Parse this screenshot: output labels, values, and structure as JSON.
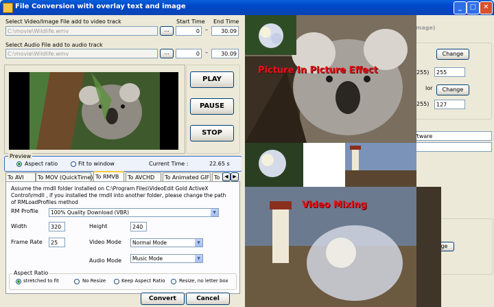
{
  "window": {
    "title": "File Conversion with overlay text and image"
  },
  "video_input": {
    "label": "Select Video/Image File add to video track",
    "path": "C:\\movie\\Wildlife.wmv",
    "browse": "...",
    "start_label": "Start Time",
    "end_label": "End Time",
    "start": "0",
    "dash": "–",
    "end": "30.09"
  },
  "audio_input": {
    "label": "Select Audio File add to audio track",
    "path": "C:\\movie\\Wildlife.wmv",
    "browse": "...",
    "start": "0",
    "dash": "–",
    "end": "30.09"
  },
  "controls": {
    "play": "PLAY",
    "pause": "PAUSE",
    "stop": "STOP"
  },
  "preview": {
    "legend": "Preview",
    "aspect": "Aspect ratio",
    "fit": "Fit to window",
    "current_label": "Current Time :",
    "current_value": "22.65 s"
  },
  "tabs": [
    "To  AVI",
    "To MOV (QuickTime)",
    "To RMVB",
    "To AVCHD",
    "To Animated GIF",
    "To"
  ],
  "rmvb": {
    "note": "Assume the rmdll folder installed on C:\\Program Files\\VideoEdit Gold ActiveX Control\\rmdll , if you installed the rmdll into another folder, please change the path of RMLoadProfiles method",
    "profile_label": "RM Profile",
    "profile_value": "100% Quality Download (VBR)",
    "width_label": "Width",
    "width_value": "320",
    "height_label": "Height",
    "height_value": "240",
    "framerate_label": "Frame Rate",
    "framerate_value": "25",
    "video_mode_label": "Video Mode",
    "video_mode_value": "Normal Mode",
    "audio_mode_label": "Audio Mode",
    "audio_mode_value": "Music Mode"
  },
  "aspect_ratio": {
    "legend": "Aspect Ratio",
    "options": [
      "stretched to fit",
      "No Resize",
      "Keep Aspect Ratio",
      "Resize, no letter box"
    ]
  },
  "actions": {
    "convert": "Convert",
    "cancel": "Cancel"
  },
  "right_panel": {
    "mage_hint": "mage)",
    "change1": "Change",
    "p255a": "255)",
    "val1": "255",
    "lor": "lor",
    "change2": "Change",
    "p255b": "255)",
    "val2": "127",
    "software": "ftware",
    "mage_btn": "age"
  },
  "overlays": {
    "pip_title": "Picture In Picture Effect",
    "mixing_title": "Video Mixing"
  }
}
